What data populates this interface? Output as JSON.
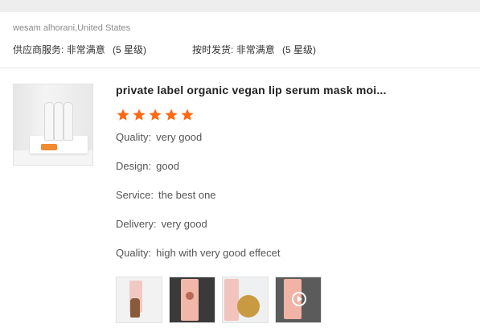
{
  "reviewer": "wesam alhorani,United States",
  "supplier_service": {
    "label": "供应商服务:",
    "value": "非常满意",
    "level": "(5 星级)"
  },
  "on_time_shipment": {
    "label": "按时发货:",
    "value": "非常满意",
    "level": "(5 星级)"
  },
  "product": {
    "title": "private label organic vegan lip serum mask moi...",
    "image_icon": "lip-serum-tubes-image"
  },
  "rating": {
    "stars": 5,
    "max": 5,
    "star_color": "#ff6a13"
  },
  "comments": [
    {
      "key": "Quality",
      "sep": ":",
      "value": "very good"
    },
    {
      "key": "Design",
      "sep": ":",
      "value": "good"
    },
    {
      "key": "Service",
      "sep": ":",
      "value": "the best one"
    },
    {
      "key": "Delivery",
      "sep": ":",
      "value": "very good"
    },
    {
      "key": "Quality",
      "sep": ":",
      "value": "high with very good effecet"
    }
  ],
  "photos": [
    {
      "icon": "product-photo-bottle"
    },
    {
      "icon": "product-photo-box"
    },
    {
      "icon": "product-photo-serum-drop"
    },
    {
      "icon": "product-video"
    }
  ],
  "colors": {
    "accent": "#ff6a13",
    "divider": "#e6e6e6",
    "topbar": "#eeeeee"
  }
}
